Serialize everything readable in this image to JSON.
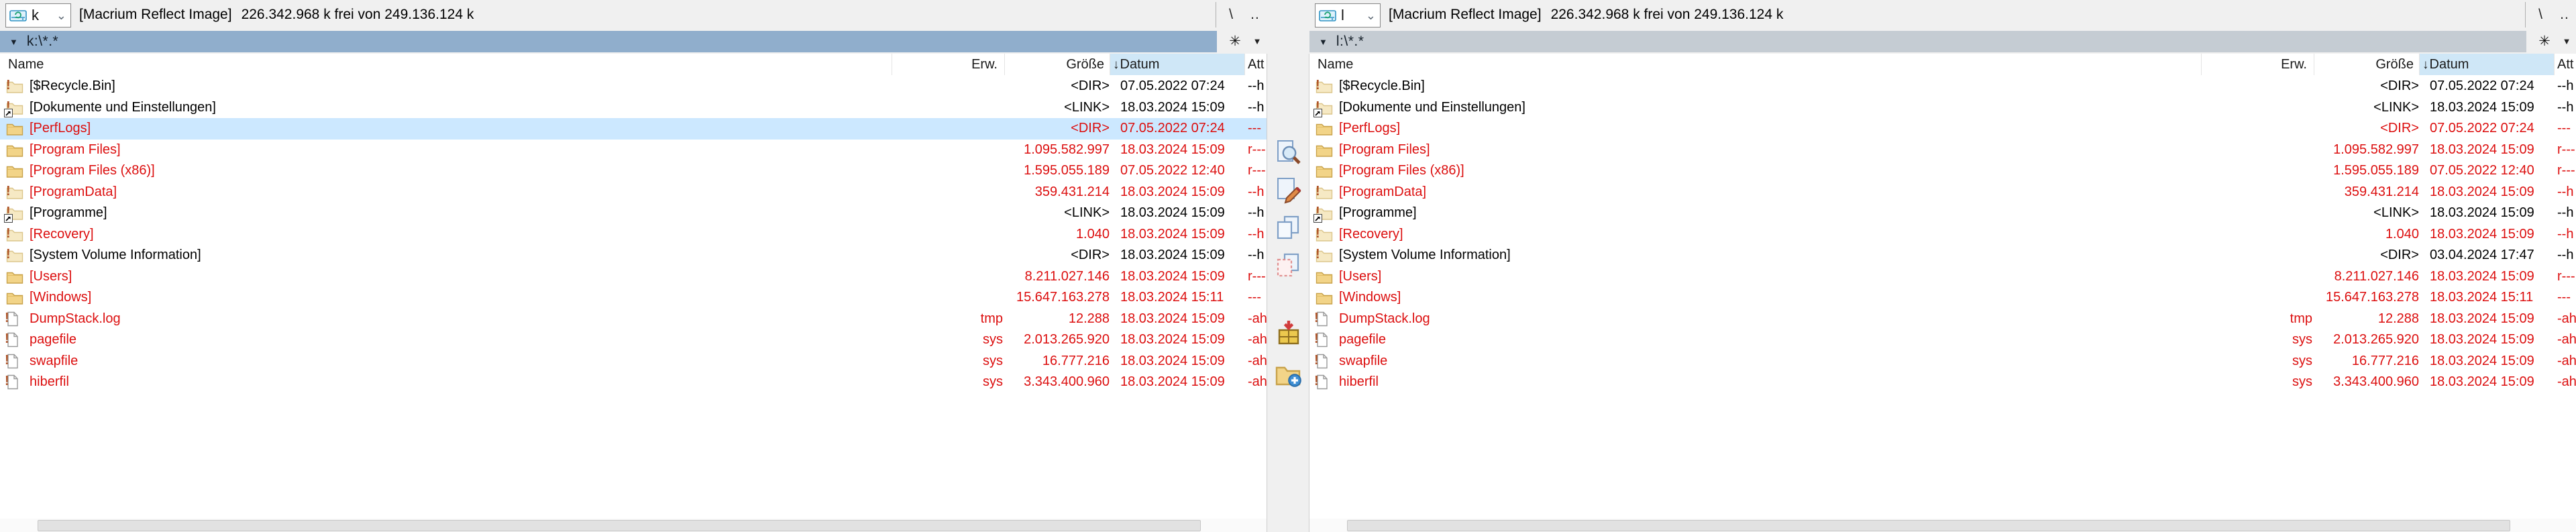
{
  "colors": {
    "window_bg": "#f0f0f0",
    "selection_bg": "#cce8ff",
    "active_path_bg": "#90aecc",
    "inactive_path_bg": "#c5ccd3",
    "sorted_header_bg": "#cfe7f7",
    "red_text": "#dc0f0f"
  },
  "glyphs": {
    "root_button": "\\",
    "parent_button": "..",
    "star_button": "✳",
    "history_button": "▼",
    "path_caret": "▼",
    "combo_chevron": "⌄",
    "sort_desc": "↓"
  },
  "middle_toolbar": {
    "items": [
      {
        "icon": "view-icon"
      },
      {
        "icon": "edit-icon"
      },
      {
        "icon": "copy-icon"
      },
      {
        "icon": "move-icon"
      },
      {
        "icon": "pack-icon"
      },
      {
        "icon": "new-folder-icon"
      }
    ]
  },
  "left_pane": {
    "drive": "k",
    "volume_label": "[Macrium Reflect Image]",
    "free_space": "226.342.968 k frei von 249.136.124 k",
    "path": "k:\\*.*",
    "active": true,
    "columns": [
      {
        "label": "Name",
        "sorted": false
      },
      {
        "label": "Erw.",
        "sorted": false
      },
      {
        "label": "Größe",
        "sorted": false
      },
      {
        "label": "Datum",
        "sorted": true
      },
      {
        "label": "Att",
        "sorted": false
      }
    ],
    "rows": [
      {
        "name": "[$Recycle.Bin]",
        "erw": "",
        "size": "<DIR>",
        "date": "07.05.2022 07:24",
        "attr": "--h",
        "color": "black",
        "icon": "hidden-folder-icon",
        "selected": false
      },
      {
        "name": "[Dokumente und Einstellungen]",
        "erw": "",
        "size": "<LINK>",
        "date": "18.03.2024 15:09",
        "attr": "--h",
        "color": "black",
        "icon": "hidden-link-folder-icon",
        "selected": false
      },
      {
        "name": "[PerfLogs]",
        "erw": "",
        "size": "<DIR>",
        "date": "07.05.2022 07:24",
        "attr": "---",
        "color": "red",
        "icon": "folder-icon",
        "selected": true
      },
      {
        "name": "[Program Files]",
        "erw": "",
        "size": "1.095.582.997",
        "date": "18.03.2024 15:09",
        "attr": "r---",
        "color": "red",
        "icon": "folder-icon",
        "selected": false
      },
      {
        "name": "[Program Files (x86)]",
        "erw": "",
        "size": "1.595.055.189",
        "date": "07.05.2022 12:40",
        "attr": "r---",
        "color": "red",
        "icon": "folder-icon",
        "selected": false
      },
      {
        "name": "[ProgramData]",
        "erw": "",
        "size": "359.431.214",
        "date": "18.03.2024 15:09",
        "attr": "--h",
        "color": "red",
        "icon": "hidden-folder-icon",
        "selected": false
      },
      {
        "name": "[Programme]",
        "erw": "",
        "size": "<LINK>",
        "date": "18.03.2024 15:09",
        "attr": "--h",
        "color": "black",
        "icon": "hidden-link-folder-icon",
        "selected": false
      },
      {
        "name": "[Recovery]",
        "erw": "",
        "size": "1.040",
        "date": "18.03.2024 15:09",
        "attr": "--h",
        "color": "red",
        "icon": "hidden-folder-icon",
        "selected": false
      },
      {
        "name": "[System Volume Information]",
        "erw": "",
        "size": "<DIR>",
        "date": "18.03.2024 15:09",
        "attr": "--h",
        "color": "black",
        "icon": "hidden-folder-icon",
        "selected": false
      },
      {
        "name": "[Users]",
        "erw": "",
        "size": "8.211.027.146",
        "date": "18.03.2024 15:09",
        "attr": "r---",
        "color": "red",
        "icon": "folder-icon",
        "selected": false
      },
      {
        "name": "[Windows]",
        "erw": "",
        "size": "15.647.163.278",
        "date": "18.03.2024 15:11",
        "attr": "---",
        "color": "red",
        "icon": "folder-icon",
        "selected": false
      },
      {
        "name": "DumpStack.log",
        "erw": "tmp",
        "size": "12.288",
        "date": "18.03.2024 15:09",
        "attr": "-ah",
        "color": "red",
        "icon": "system-file-icon",
        "selected": false
      },
      {
        "name": "pagefile",
        "erw": "sys",
        "size": "2.013.265.920",
        "date": "18.03.2024 15:09",
        "attr": "-ah",
        "color": "red",
        "icon": "system-file-icon",
        "selected": false
      },
      {
        "name": "swapfile",
        "erw": "sys",
        "size": "16.777.216",
        "date": "18.03.2024 15:09",
        "attr": "-ah",
        "color": "red",
        "icon": "system-file-icon",
        "selected": false
      },
      {
        "name": "hiberfil",
        "erw": "sys",
        "size": "3.343.400.960",
        "date": "18.03.2024 15:09",
        "attr": "-ah",
        "color": "red",
        "icon": "system-file-icon",
        "selected": false
      }
    ]
  },
  "right_pane": {
    "drive": "l",
    "volume_label": "[Macrium Reflect Image]",
    "free_space": "226.342.968 k frei von 249.136.124 k",
    "path": "l:\\*.*",
    "active": false,
    "columns": [
      {
        "label": "Name",
        "sorted": false
      },
      {
        "label": "Erw.",
        "sorted": false
      },
      {
        "label": "Größe",
        "sorted": false
      },
      {
        "label": "Datum",
        "sorted": true
      },
      {
        "label": "Att",
        "sorted": false
      }
    ],
    "rows": [
      {
        "name": "[$Recycle.Bin]",
        "erw": "",
        "size": "<DIR>",
        "date": "07.05.2022 07:24",
        "attr": "--h",
        "color": "black",
        "icon": "hidden-folder-icon",
        "selected": false
      },
      {
        "name": "[Dokumente und Einstellungen]",
        "erw": "",
        "size": "<LINK>",
        "date": "18.03.2024 15:09",
        "attr": "--h",
        "color": "black",
        "icon": "hidden-link-folder-icon",
        "selected": false
      },
      {
        "name": "[PerfLogs]",
        "erw": "",
        "size": "<DIR>",
        "date": "07.05.2022 07:24",
        "attr": "---",
        "color": "red",
        "icon": "folder-icon",
        "selected": false
      },
      {
        "name": "[Program Files]",
        "erw": "",
        "size": "1.095.582.997",
        "date": "18.03.2024 15:09",
        "attr": "r---",
        "color": "red",
        "icon": "folder-icon",
        "selected": false
      },
      {
        "name": "[Program Files (x86)]",
        "erw": "",
        "size": "1.595.055.189",
        "date": "07.05.2022 12:40",
        "attr": "r---",
        "color": "red",
        "icon": "folder-icon",
        "selected": false
      },
      {
        "name": "[ProgramData]",
        "erw": "",
        "size": "359.431.214",
        "date": "18.03.2024 15:09",
        "attr": "--h",
        "color": "red",
        "icon": "hidden-folder-icon",
        "selected": false
      },
      {
        "name": "[Programme]",
        "erw": "",
        "size": "<LINK>",
        "date": "18.03.2024 15:09",
        "attr": "--h",
        "color": "black",
        "icon": "hidden-link-folder-icon",
        "selected": false
      },
      {
        "name": "[Recovery]",
        "erw": "",
        "size": "1.040",
        "date": "18.03.2024 15:09",
        "attr": "--h",
        "color": "red",
        "icon": "hidden-folder-icon",
        "selected": false
      },
      {
        "name": "[System Volume Information]",
        "erw": "",
        "size": "<DIR>",
        "date": "03.04.2024 17:47",
        "attr": "--h",
        "color": "black",
        "icon": "hidden-folder-icon",
        "selected": false
      },
      {
        "name": "[Users]",
        "erw": "",
        "size": "8.211.027.146",
        "date": "18.03.2024 15:09",
        "attr": "r---",
        "color": "red",
        "icon": "folder-icon",
        "selected": false
      },
      {
        "name": "[Windows]",
        "erw": "",
        "size": "15.647.163.278",
        "date": "18.03.2024 15:11",
        "attr": "---",
        "color": "red",
        "icon": "folder-icon",
        "selected": false
      },
      {
        "name": "DumpStack.log",
        "erw": "tmp",
        "size": "12.288",
        "date": "18.03.2024 15:09",
        "attr": "-ah",
        "color": "red",
        "icon": "system-file-icon",
        "selected": false
      },
      {
        "name": "pagefile",
        "erw": "sys",
        "size": "2.013.265.920",
        "date": "18.03.2024 15:09",
        "attr": "-ah",
        "color": "red",
        "icon": "system-file-icon",
        "selected": false
      },
      {
        "name": "swapfile",
        "erw": "sys",
        "size": "16.777.216",
        "date": "18.03.2024 15:09",
        "attr": "-ah",
        "color": "red",
        "icon": "system-file-icon",
        "selected": false
      },
      {
        "name": "hiberfil",
        "erw": "sys",
        "size": "3.343.400.960",
        "date": "18.03.2024 15:09",
        "attr": "-ah",
        "color": "red",
        "icon": "system-file-icon",
        "selected": false
      }
    ]
  }
}
